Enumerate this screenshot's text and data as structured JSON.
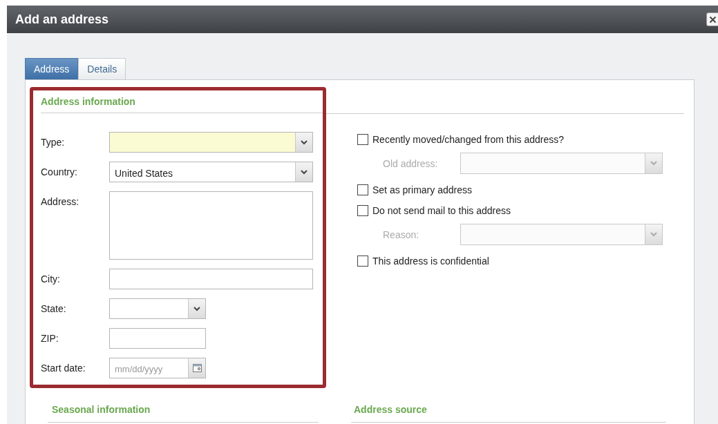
{
  "window": {
    "title": "Add an address"
  },
  "tabs": [
    {
      "label": "Address",
      "selected": true
    },
    {
      "label": "Details",
      "selected": false
    }
  ],
  "address_information": {
    "title": "Address information",
    "fields": [
      {
        "label": "Type:",
        "kind": "dropdown",
        "required": true
      },
      {
        "label": "Country:",
        "kind": "dropdown",
        "required": false,
        "value": "United States"
      },
      {
        "label": "Address:",
        "kind": "textarea",
        "required": false
      },
      {
        "label": "City:",
        "kind": "text",
        "required": false
      },
      {
        "label": "State:",
        "kind": "small_dropdown",
        "required": false
      },
      {
        "label": "ZIP:",
        "kind": "small_text",
        "required": false
      },
      {
        "label": "Start date:",
        "kind": "date",
        "required": false,
        "placeholder": "mm/dd/yyyy"
      }
    ]
  },
  "options": [
    {
      "kind": "checkbox",
      "label": "Recently moved/changed from this address?",
      "checked": false
    },
    {
      "kind": "dropdown",
      "label": "Old address:",
      "disabled": true
    },
    {
      "kind": "checkbox",
      "label": "Set as primary address",
      "checked": false
    },
    {
      "kind": "checkbox",
      "label": "Do not send mail to this address",
      "checked": false
    },
    {
      "kind": "dropdown",
      "label": "Reason:",
      "disabled": true
    },
    {
      "kind": "checkbox",
      "label": "This address is confidential",
      "checked": false
    }
  ],
  "sections": [
    {
      "title": "Seasonal information"
    },
    {
      "title": "Address source"
    }
  ]
}
